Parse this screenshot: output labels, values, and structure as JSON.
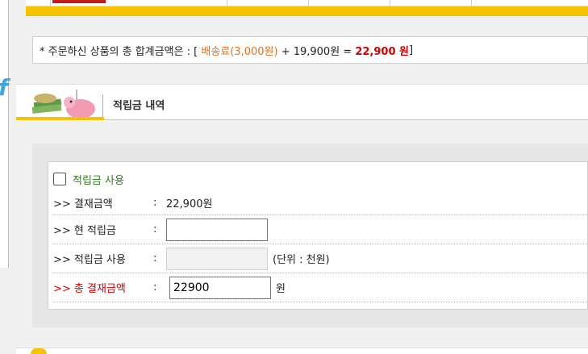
{
  "colors": {
    "yellow": "#f5c200",
    "orange": "#e0711b",
    "red": "#cc0000",
    "green": "#2e7d1a"
  },
  "summary": {
    "prefix": "* 주문하신 상품의 총 합계금액은 : [ ",
    "shipping": "배송료(3,000원)",
    "middle": " + 19,900원 = ",
    "total": "22,900 원",
    "suffix": "]"
  },
  "section": {
    "title": "적립금 내역",
    "icon": "piggy-bank-money-icon"
  },
  "form": {
    "checkbox_label": "적립금 사용",
    "payment": {
      "label": ">> 결재금액",
      "colon": ":",
      "value": "22,900원"
    },
    "current": {
      "label": ">> 현 적립금",
      "colon": ":",
      "value": ""
    },
    "use": {
      "label": ">> 적립금 사용",
      "colon": ":",
      "value": "",
      "unit": "(단위 : 천원)"
    },
    "total": {
      "label": ">> 총 결재금액",
      "colon": ":",
      "value": "22900",
      "unit": "원"
    }
  }
}
